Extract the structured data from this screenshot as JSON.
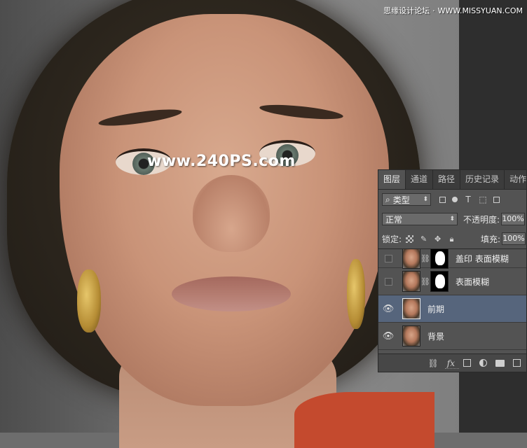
{
  "watermark": "www.240PS.com",
  "site_mark": {
    "left": "思缘设计论坛",
    "right": "WWW.MISSYUAN.COM"
  },
  "panel": {
    "tabs": [
      {
        "label": "图层",
        "active": true
      },
      {
        "label": "通道",
        "active": false
      },
      {
        "label": "路径",
        "active": false
      },
      {
        "label": "历史记录",
        "active": false
      },
      {
        "label": "动作",
        "active": false
      }
    ],
    "filter": {
      "search_glyph": "⌕",
      "value": "类型",
      "icons": [
        "image-filter-icon",
        "adjustment-filter-icon",
        "text-filter-icon",
        "shape-filter-icon",
        "smart-object-filter-icon"
      ]
    },
    "blend": {
      "mode": "正常",
      "opacity_label": "不透明度:",
      "opacity_value": "100%"
    },
    "lock": {
      "label": "锁定:",
      "fill_label": "填充:",
      "fill_value": "100%"
    },
    "layers": [
      {
        "name": "盖印 表面模糊",
        "visible": false,
        "has_mask": true,
        "selected": false
      },
      {
        "name": "表面模糊",
        "visible": false,
        "has_mask": true,
        "selected": false
      },
      {
        "name": "前期",
        "visible": true,
        "has_mask": false,
        "selected": true
      },
      {
        "name": "背景",
        "visible": true,
        "has_mask": false,
        "selected": false
      }
    ],
    "bottom_bar": {
      "link_glyph": "⛓",
      "fx_label": "fx"
    }
  },
  "colors": {
    "panel_bg": "#535353",
    "selected_layer": "#56657c",
    "tab_bar": "#3c3c3c",
    "shirt": "#c44a2e"
  }
}
